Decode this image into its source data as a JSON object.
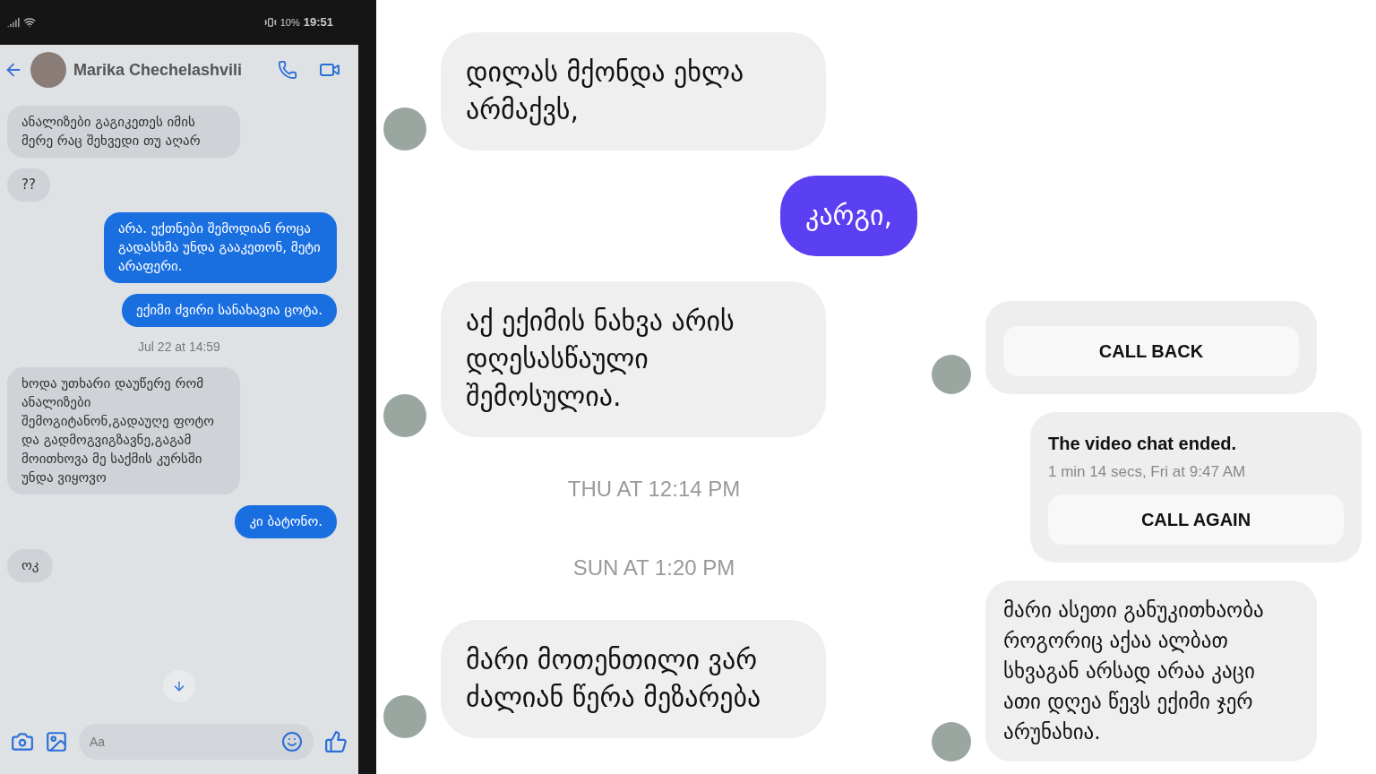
{
  "phone": {
    "status_bar": {
      "battery": "10%",
      "time": "19:51"
    },
    "header": {
      "contact_name": "Marika Chechelashvili"
    },
    "items": [
      {
        "kind": "incoming",
        "text": "ანალიზები გაგიკეთეს იმის მერე რაც შეხვედი თუ აღარ"
      },
      {
        "kind": "incoming",
        "text": "??"
      },
      {
        "kind": "outgoing",
        "text": "არა. ექთნები შემოდიან როცა გადასხმა უნდა გააკეთონ, მეტი არაფერი."
      },
      {
        "kind": "outgoing",
        "text": "ექიმი ძვირი სანახავია ცოტა."
      },
      {
        "kind": "timestamp",
        "text": "Jul 22 at 14:59"
      },
      {
        "kind": "incoming",
        "text": "ხოდა უთხარი დაუწერე რომ ანალიზები შემოგიტანონ,გადაუღე ფოტო და გადმოგვიგზავნე,გაგამ მოითხოვა მე საქმის კურსში უნდა ვიყოვო"
      },
      {
        "kind": "outgoing",
        "text": "კი ბატონო."
      },
      {
        "kind": "incoming",
        "text": "ოკ"
      }
    ],
    "composer": {
      "placeholder": "Aa"
    }
  },
  "middle": {
    "items": [
      {
        "kind": "incoming",
        "text": "დილას მქონდა ეხლა არმაქვს,"
      },
      {
        "kind": "outgoing",
        "text": "კარგი,"
      },
      {
        "kind": "incoming",
        "text": "აქ ექიმის ნახვა არის დღესასწაული შემოსულია."
      },
      {
        "kind": "timestamp",
        "text": "THU AT 12:14 PM"
      },
      {
        "kind": "timestamp",
        "text": "SUN AT 1:20 PM"
      },
      {
        "kind": "incoming",
        "text": "მარი მოთენთილი ვარ ძალიან წერა მეზარება"
      }
    ]
  },
  "right": {
    "items": [
      {
        "kind": "incoming_call",
        "button": "CALL BACK"
      },
      {
        "kind": "outgoing_call",
        "title": "The video chat ended.",
        "detail": "1 min 14 secs, Fri at 9:47 AM",
        "button": "CALL AGAIN"
      },
      {
        "kind": "incoming",
        "text": "მარი ასეთი განუკითხაობა როგორიც აქაა ალბათ სხვაგან არსად არაა კაცი ათი დღეა წევს ექიმი ჯერ არუნახია."
      }
    ]
  }
}
